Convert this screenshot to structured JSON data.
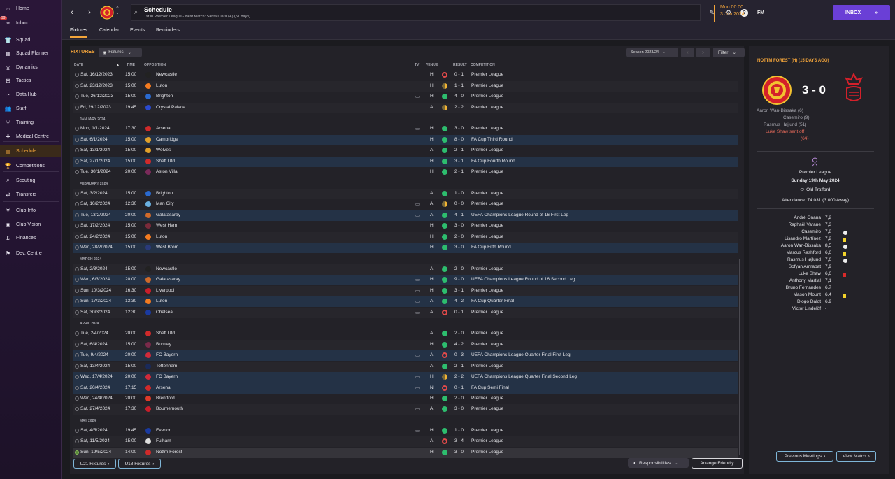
{
  "nav": [
    {
      "label": "Home",
      "icon": "home-icon",
      "glyph": "⌂"
    },
    {
      "label": "Inbox",
      "icon": "inbox-icon",
      "glyph": "✉",
      "badge": "99"
    },
    {
      "label": "Squad",
      "icon": "squad-icon",
      "glyph": "👕"
    },
    {
      "label": "Squad Planner",
      "icon": "planner-icon",
      "glyph": "▦"
    },
    {
      "label": "Dynamics",
      "icon": "dynamics-icon",
      "glyph": "◎"
    },
    {
      "label": "Tactics",
      "icon": "tactics-icon",
      "glyph": "⊞"
    },
    {
      "label": "Data Hub",
      "icon": "data-hub-icon",
      "glyph": "◔"
    },
    {
      "label": "Staff",
      "icon": "staff-icon",
      "glyph": "👥"
    },
    {
      "label": "Training",
      "icon": "training-icon",
      "glyph": "⛉"
    },
    {
      "label": "Medical Centre",
      "icon": "medical-icon",
      "glyph": "✚"
    },
    {
      "label": "Schedule",
      "icon": "schedule-icon",
      "glyph": "▤",
      "active": true
    },
    {
      "label": "Competitions",
      "icon": "trophy-icon",
      "glyph": "🏆"
    },
    {
      "label": "Scouting",
      "icon": "scouting-icon",
      "glyph": "⌕"
    },
    {
      "label": "Transfers",
      "icon": "transfers-icon",
      "glyph": "⇄"
    },
    {
      "label": "Club Info",
      "icon": "club-info-icon",
      "glyph": "⛨"
    },
    {
      "label": "Club Vision",
      "icon": "club-vision-icon",
      "glyph": "◉"
    },
    {
      "label": "Finances",
      "icon": "finances-icon",
      "glyph": "£"
    },
    {
      "label": "Dev. Centre",
      "icon": "dev-centre-icon",
      "glyph": "⚑"
    }
  ],
  "header": {
    "title": "Schedule",
    "subtitle": "1st in Premier League - Next Match: Santa Clara (A) (51 days)",
    "date_line1": "Mon 00:00",
    "date_line2": "3 Jun 2024",
    "inbox_label": "INBOX",
    "fm_label": "FM"
  },
  "tabs": [
    "Fixtures",
    "Calendar",
    "Events",
    "Reminders"
  ],
  "fixtures": {
    "title": "FIXTURES",
    "view_label": "Fixtures",
    "season_label": "Season 2023/24",
    "filter_label": "Filter",
    "columns": {
      "date": "DATE",
      "time": "TIME",
      "opposition": "OPPOSITION",
      "tv": "TV",
      "venue": "VENUE",
      "result": "RESULT",
      "competition": "COMPETITION"
    },
    "months": {
      "jan": "JANUARY 2024",
      "feb": "FEBRUARY 2024",
      "mar": "MARCH 2024",
      "apr": "APRIL 2024",
      "may": "MAY 2024"
    },
    "rows": [
      {
        "date": "Sat, 16/12/2023",
        "time": "15:00",
        "opp": "Newcastle",
        "color": "#222",
        "tv": false,
        "venue": "H",
        "res": "L",
        "score": "0 - 1",
        "comp": "Premier League"
      },
      {
        "date": "Sat, 23/12/2023",
        "time": "15:00",
        "opp": "Luton",
        "color": "#f47b20",
        "tv": false,
        "venue": "H",
        "res": "D",
        "score": "1 - 1",
        "comp": "Premier League"
      },
      {
        "date": "Tue, 26/12/2023",
        "time": "15:00",
        "opp": "Brighton",
        "color": "#2a6ad0",
        "tv": true,
        "venue": "H",
        "res": "W",
        "score": "4 - 0",
        "comp": "Premier League"
      },
      {
        "date": "Fri, 29/12/2023",
        "time": "19:45",
        "opp": "Crystal Palace",
        "color": "#2a4ad0",
        "tv": false,
        "venue": "A",
        "res": "D",
        "score": "2 - 2",
        "comp": "Premier League"
      },
      {
        "date": "Mon, 1/1/2024",
        "time": "17:30",
        "opp": "Arsenal",
        "color": "#d02a2a",
        "tv": true,
        "venue": "H",
        "res": "W",
        "score": "3 - 0",
        "comp": "Premier League"
      },
      {
        "date": "Sat, 6/1/2024",
        "time": "15:00",
        "opp": "Cambridge",
        "color": "#e0a02a",
        "tv": false,
        "venue": "H",
        "res": "W",
        "score": "8 - 0",
        "comp": "FA Cup Third Round"
      },
      {
        "date": "Sat, 13/1/2024",
        "time": "15:00",
        "opp": "Wolves",
        "color": "#e0a02a",
        "tv": false,
        "venue": "A",
        "res": "W",
        "score": "2 - 1",
        "comp": "Premier League"
      },
      {
        "date": "Sat, 27/1/2024",
        "time": "15:00",
        "opp": "Sheff Utd",
        "color": "#d02a2a",
        "tv": false,
        "venue": "H",
        "res": "W",
        "score": "3 - 1",
        "comp": "FA Cup Fourth Round"
      },
      {
        "date": "Tue, 30/1/2024",
        "time": "20:00",
        "opp": "Aston Villa",
        "color": "#7a2a5a",
        "tv": false,
        "venue": "H",
        "res": "W",
        "score": "2 - 1",
        "comp": "Premier League"
      },
      {
        "date": "Sat, 3/2/2024",
        "time": "15:00",
        "opp": "Brighton",
        "color": "#2a6ad0",
        "tv": false,
        "venue": "A",
        "res": "W",
        "score": "1 - 0",
        "comp": "Premier League"
      },
      {
        "date": "Sat, 10/2/2024",
        "time": "12:30",
        "opp": "Man City",
        "color": "#6ab0e0",
        "tv": true,
        "venue": "A",
        "res": "D",
        "score": "0 - 0",
        "comp": "Premier League"
      },
      {
        "date": "Tue, 13/2/2024",
        "time": "20:00",
        "opp": "Galatasaray",
        "color": "#d06a2a",
        "tv": true,
        "venue": "A",
        "res": "W",
        "score": "4 - 1",
        "comp": "UEFA Champions League Round of 16 First Leg"
      },
      {
        "date": "Sat, 17/2/2024",
        "time": "15:00",
        "opp": "West Ham",
        "color": "#7a2a3a",
        "tv": false,
        "venue": "H",
        "res": "W",
        "score": "3 - 0",
        "comp": "Premier League"
      },
      {
        "date": "Sat, 24/2/2024",
        "time": "15:00",
        "opp": "Luton",
        "color": "#f47b20",
        "tv": false,
        "venue": "H",
        "res": "W",
        "score": "2 - 0",
        "comp": "Premier League"
      },
      {
        "date": "Wed, 28/2/2024",
        "time": "15:00",
        "opp": "West Brom",
        "color": "#2a3a7a",
        "tv": false,
        "venue": "H",
        "res": "W",
        "score": "3 - 0",
        "comp": "FA Cup Fifth Round"
      },
      {
        "date": "Sat, 2/3/2024",
        "time": "15:00",
        "opp": "Newcastle",
        "color": "#222",
        "tv": false,
        "venue": "A",
        "res": "W",
        "score": "2 - 0",
        "comp": "Premier League"
      },
      {
        "date": "Wed, 6/3/2024",
        "time": "20:00",
        "opp": "Galatasaray",
        "color": "#d06a2a",
        "tv": true,
        "venue": "H",
        "res": "W",
        "score": "9 - 0",
        "comp": "UEFA Champions League Round of 16 Second Leg"
      },
      {
        "date": "Sun, 10/3/2024",
        "time": "16:30",
        "opp": "Liverpool",
        "color": "#c81e2a",
        "tv": true,
        "venue": "H",
        "res": "W",
        "score": "3 - 1",
        "comp": "Premier League"
      },
      {
        "date": "Sun, 17/3/2024",
        "time": "13:30",
        "opp": "Luton",
        "color": "#f47b20",
        "tv": true,
        "venue": "A",
        "res": "W",
        "score": "4 - 2",
        "comp": "FA Cup Quarter Final"
      },
      {
        "date": "Sat, 30/3/2024",
        "time": "12:30",
        "opp": "Chelsea",
        "color": "#1a3aa0",
        "tv": true,
        "venue": "A",
        "res": "L",
        "score": "0 - 1",
        "comp": "Premier League"
      },
      {
        "date": "Tue, 2/4/2024",
        "time": "20:00",
        "opp": "Sheff Utd",
        "color": "#d02a2a",
        "tv": false,
        "venue": "A",
        "res": "W",
        "score": "2 - 0",
        "comp": "Premier League"
      },
      {
        "date": "Sat, 6/4/2024",
        "time": "15:00",
        "opp": "Burnley",
        "color": "#7a2a4a",
        "tv": false,
        "venue": "H",
        "res": "W",
        "score": "4 - 2",
        "comp": "Premier League"
      },
      {
        "date": "Tue, 9/4/2024",
        "time": "20:00",
        "opp": "FC Bayern",
        "color": "#d02a3a",
        "tv": true,
        "venue": "A",
        "res": "L",
        "score": "0 - 3",
        "comp": "UEFA Champions League Quarter Final First Leg"
      },
      {
        "date": "Sat, 13/4/2024",
        "time": "15:00",
        "opp": "Tottenham",
        "color": "#1a2a5a",
        "tv": false,
        "venue": "A",
        "res": "W",
        "score": "2 - 1",
        "comp": "Premier League"
      },
      {
        "date": "Wed, 17/4/2024",
        "time": "20:00",
        "opp": "FC Bayern",
        "color": "#d02a3a",
        "tv": true,
        "venue": "H",
        "res": "D",
        "score": "2 - 2",
        "comp": "UEFA Champions League Quarter Final Second Leg"
      },
      {
        "date": "Sat, 20/4/2024",
        "time": "17:15",
        "opp": "Arsenal",
        "color": "#d02a2a",
        "tv": true,
        "venue": "N",
        "res": "L",
        "score": "0 - 1",
        "comp": "FA Cup Semi Final"
      },
      {
        "date": "Wed, 24/4/2024",
        "time": "20:00",
        "opp": "Brentford",
        "color": "#e03a2a",
        "tv": false,
        "venue": "H",
        "res": "W",
        "score": "2 - 0",
        "comp": "Premier League"
      },
      {
        "date": "Sat, 27/4/2024",
        "time": "17:30",
        "opp": "Bournemouth",
        "color": "#c81e2a",
        "tv": true,
        "venue": "A",
        "res": "W",
        "score": "3 - 0",
        "comp": "Premier League"
      },
      {
        "date": "Sat, 4/5/2024",
        "time": "19:45",
        "opp": "Everton",
        "color": "#1a3aa0",
        "tv": true,
        "venue": "H",
        "res": "W",
        "score": "1 - 0",
        "comp": "Premier League"
      },
      {
        "date": "Sat, 11/5/2024",
        "time": "15:00",
        "opp": "Fulham",
        "color": "#ddd",
        "tv": false,
        "venue": "A",
        "res": "L",
        "score": "3 - 4",
        "comp": "Premier League"
      },
      {
        "date": "Sun, 19/5/2024",
        "time": "14:00",
        "opp": "Nottm Forest",
        "color": "#d02a2a",
        "tv": false,
        "venue": "H",
        "res": "W",
        "score": "3 - 0",
        "comp": "Premier League"
      }
    ],
    "footer": {
      "u21": "U21 Fixtures",
      "u18": "U18 Fixtures",
      "responsibilities": "Responsibilities",
      "arrange": "Arrange Friendly"
    }
  },
  "match": {
    "title": "NOTTM FOREST (H) (15 DAYS AGO)",
    "score": "3 - 0",
    "scorers": [
      "Aaron Wan-Bissaka (6)",
      "Casemiro (9)",
      "Rasmus Højlund (51)",
      "Luke Shaw sent off",
      "(64)"
    ],
    "competition": "Premier League",
    "date": "Sunday 19th May 2024",
    "stadium": "Old Trafford",
    "attendance": "Attendance: 74.031 (3.000 Away)",
    "ratings": [
      {
        "name": "André Onana",
        "val": "7,2",
        "ev": ""
      },
      {
        "name": "Raphaël Varane",
        "val": "7,3",
        "ev": ""
      },
      {
        "name": "Casemiro",
        "val": "7,8",
        "ev": "ball"
      },
      {
        "name": "Lisandro Martínez",
        "val": "7,2",
        "ev": "yellow"
      },
      {
        "name": "Aaron Wan-Bissaka",
        "val": "8,5",
        "ev": "ball"
      },
      {
        "name": "Marcus Rashford",
        "val": "6,6",
        "ev": "yellow"
      },
      {
        "name": "Rasmus Højlund",
        "val": "7,6",
        "ev": "ball"
      },
      {
        "name": "Sofyan Amrabat",
        "val": "7,9",
        "ev": ""
      },
      {
        "name": "Luke Shaw",
        "val": "6,6",
        "ev": "red"
      },
      {
        "name": "Anthony Martial",
        "val": "7,1",
        "ev": ""
      },
      {
        "name": "Bruno Fernandes",
        "val": "6,7",
        "ev": ""
      },
      {
        "name": "Mason Mount",
        "val": "6,4",
        "ev": "yellow"
      },
      {
        "name": "Diogo Dalot",
        "val": "6,9",
        "ev": ""
      },
      {
        "name": "Victor Lindelöf",
        "val": "-",
        "ev": ""
      }
    ],
    "prev_label": "Previous Meetings",
    "view_label": "View Match"
  }
}
